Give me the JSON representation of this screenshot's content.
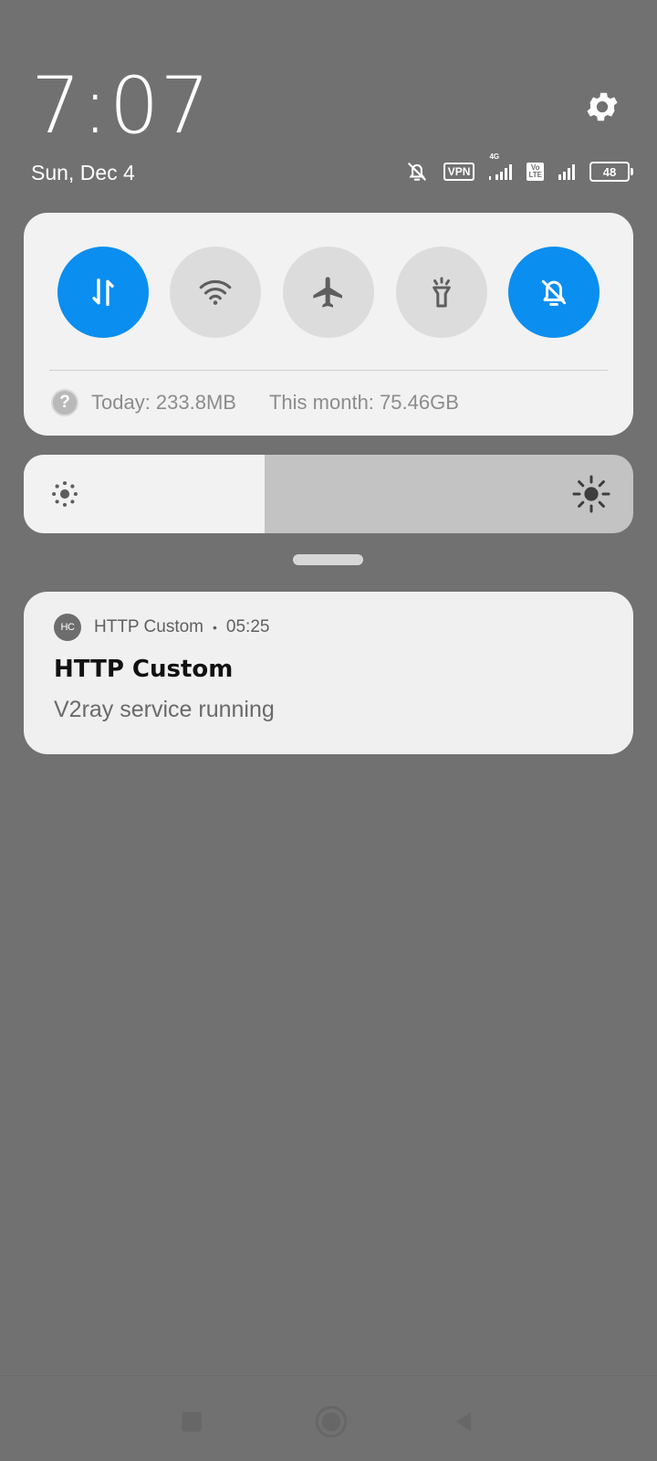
{
  "clock": {
    "time": "7:07",
    "date": "Sun, Dec 4"
  },
  "status_bar": {
    "icons": [
      "bell-off-icon",
      "vpn-icon",
      "signal-4g-icon",
      "volte-icon",
      "signal-icon",
      "battery-icon"
    ],
    "vpn_label": "VPN",
    "network_type": "4G",
    "volte_label": "Vo LTE",
    "battery_level": "48"
  },
  "quick_settings": {
    "tiles": [
      {
        "name": "mobile-data",
        "icon": "data-arrows-icon",
        "active": true
      },
      {
        "name": "wifi",
        "icon": "wifi-icon",
        "active": false
      },
      {
        "name": "airplane-mode",
        "icon": "airplane-icon",
        "active": false
      },
      {
        "name": "flashlight",
        "icon": "flashlight-icon",
        "active": false
      },
      {
        "name": "silent-mode",
        "icon": "bell-off-icon",
        "active": true
      }
    ],
    "usage_today": "Today: 233.8MB",
    "usage_month": "This month: 75.46GB"
  },
  "brightness": {
    "level_fraction": 0.395
  },
  "notification": {
    "app_icon_text": "HC",
    "app_name": "HTTP Custom",
    "separator": "•",
    "time": "05:25",
    "title": "HTTP Custom",
    "text": "V2ray service running"
  },
  "colors": {
    "background": "#717171",
    "accent": "#0a8ef0",
    "panel": "#f2f2f2",
    "tile_off": "#dcdcdc"
  }
}
